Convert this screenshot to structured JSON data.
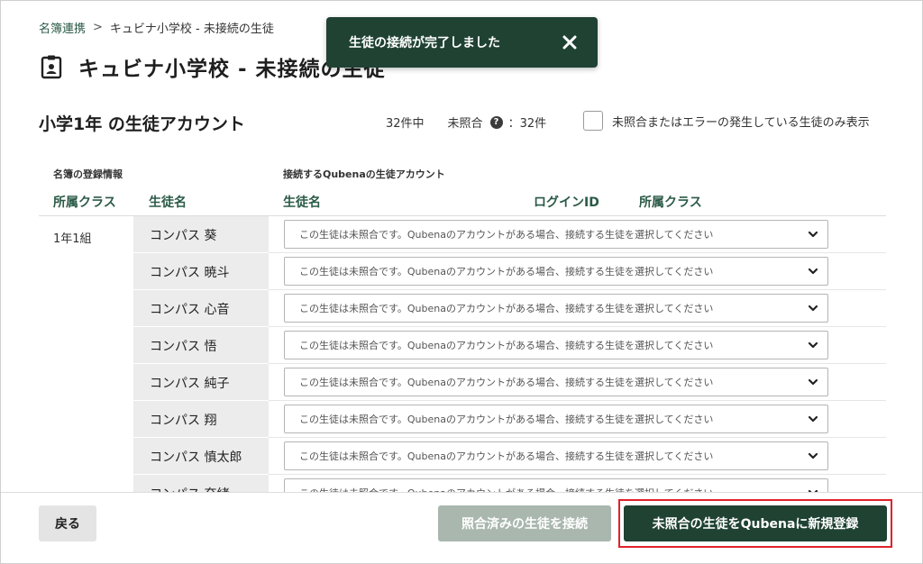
{
  "breadcrumb": {
    "root": "名簿連携",
    "separator": ">",
    "current": "キュビナ小学校 - 未接続の生徒"
  },
  "page": {
    "title": "キュビナ小学校 - 未接続の生徒",
    "title_icon": "id-badge-icon"
  },
  "toast": {
    "message": "生徒の接続が完了しました",
    "close_icon": "close-icon"
  },
  "section": {
    "title": "小学1年 の生徒アカウント",
    "total": "32件中",
    "unmatched_label": "未照合",
    "unmatched_value": "：32件",
    "filter_label": "未照合またはエラーの発生している生徒のみ表示"
  },
  "table": {
    "group_roster": "名簿の登録情報",
    "group_qubena": "接続するQubenaの生徒アカウント",
    "col_class": "所属クラス",
    "col_name": "生徒名",
    "col_q_name": "生徒名",
    "col_login": "ログインID",
    "col_q_class": "所属クラス",
    "class_value": "1年1組",
    "select_placeholder": "この生徒は未照合です。Qubenaのアカウントがある場合、接続する生徒を選択してください",
    "rows": [
      {
        "name": "コンパス 葵"
      },
      {
        "name": "コンパス 暁斗"
      },
      {
        "name": "コンパス 心音"
      },
      {
        "name": "コンパス 悟"
      },
      {
        "name": "コンパス 純子"
      },
      {
        "name": "コンパス 翔"
      },
      {
        "name": "コンパス 慎太郎"
      },
      {
        "name": "コンパス 奈緒"
      }
    ]
  },
  "footer": {
    "back_label": "戻る",
    "connect_label": "照合済みの生徒を接続",
    "register_label": "未照合の生徒をQubenaに新規登録"
  },
  "colors": {
    "primary": "#1f4233",
    "accent_text": "#2b5a47",
    "disabled_button": "#a9b7ae",
    "highlight": "#e0212b"
  }
}
